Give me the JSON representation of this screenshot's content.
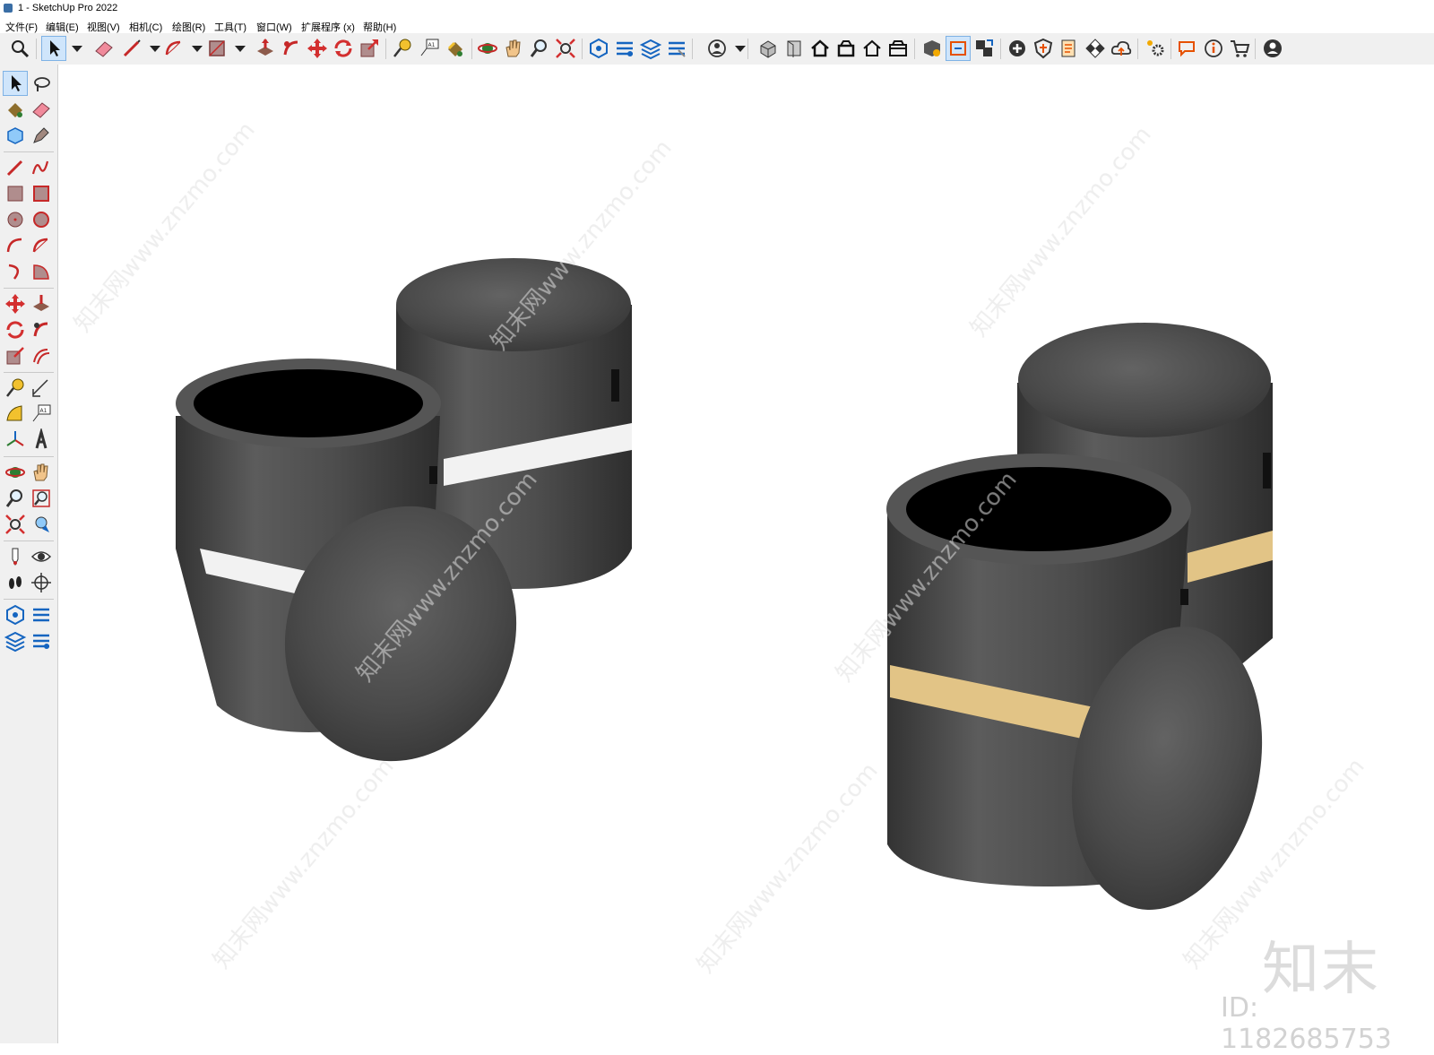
{
  "window": {
    "title": "1 - SketchUp Pro 2022"
  },
  "menu": [
    "文件(F)",
    "编辑(E)",
    "视图(V)",
    "相机(C)",
    "绘图(R)",
    "工具(T)",
    "窗口(W)",
    "扩展程序 (x)",
    "帮助(H)"
  ],
  "watermark": {
    "logo": "知末",
    "id": "ID: 1182685753",
    "text": "知末网www.znzmo.com"
  },
  "colors": {
    "accent": "#cfe5fb",
    "velvet": "#4d4d4d",
    "white_band": "#f2f2f2",
    "gold_band": "#e2c486"
  }
}
